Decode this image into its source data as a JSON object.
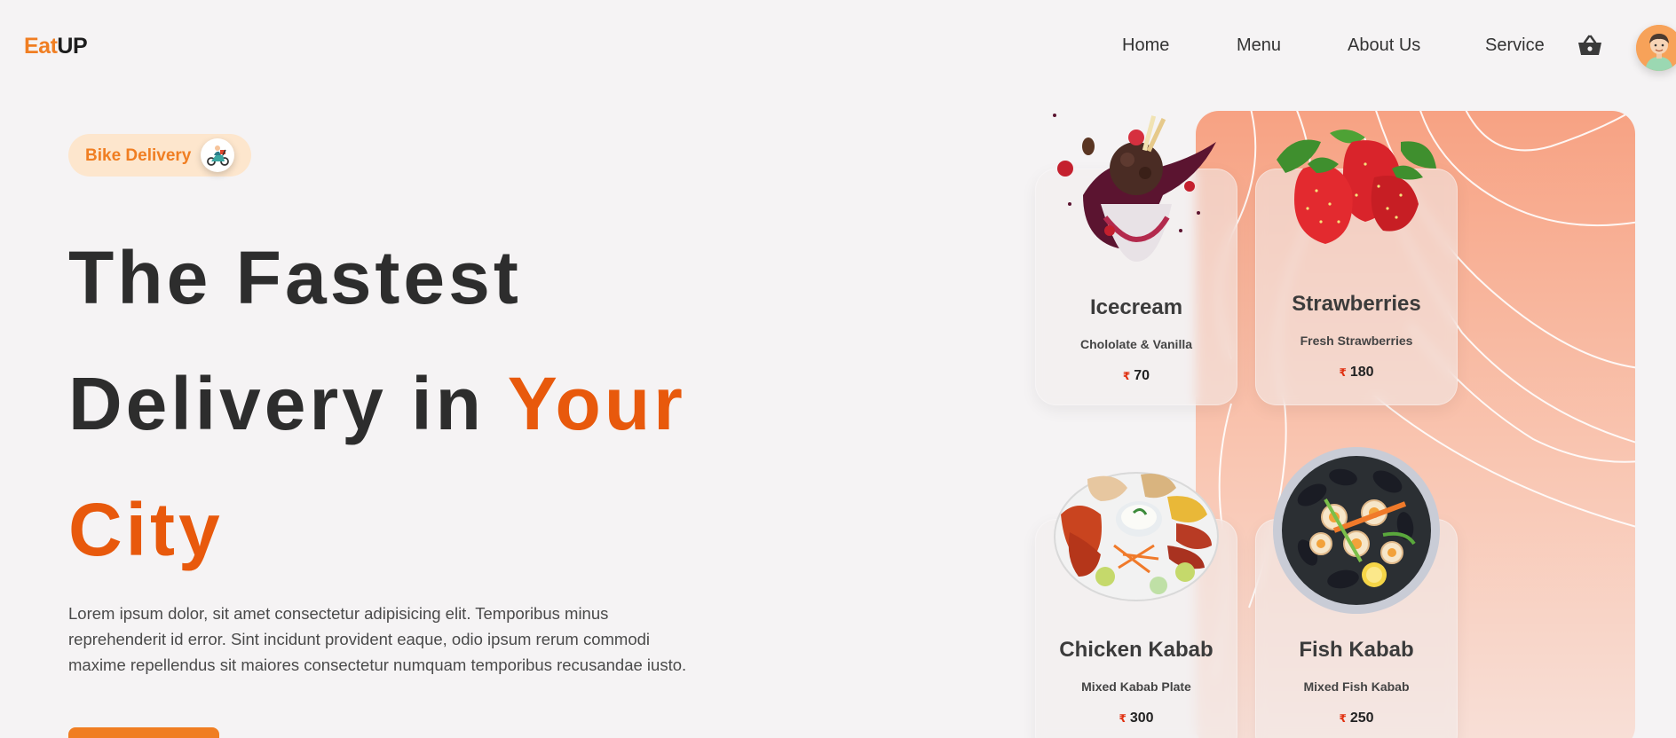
{
  "brand": {
    "part1": "Eat",
    "part2": "UP"
  },
  "nav": {
    "items": [
      "Home",
      "Menu",
      "About Us",
      "Service"
    ],
    "cart_icon": "basket-icon",
    "avatar_icon": "user-avatar"
  },
  "hero": {
    "badge": {
      "label": "Bike Delivery",
      "icon": "scooter-icon"
    },
    "headline": {
      "line1": "The Fastest",
      "line2_plain": "Delivery in",
      "line2_accent": "Your",
      "line3_accent": "City"
    },
    "description": "Lorem ipsum dolor, sit amet consectetur adipisicing elit. Temporibus minus reprehenderit id error. Sint incidunt provident eaque, odio ipsum rerum commodi maxime repellendus sit maiores consectetur numquam temporibus recusandae iusto."
  },
  "menu": [
    {
      "name": "Icecream",
      "desc": "Chololate & Vanilla",
      "currency": "₹",
      "price": "70",
      "image": "icecream-image"
    },
    {
      "name": "Strawberries",
      "desc": "Fresh Strawberries",
      "currency": "₹",
      "price": "180",
      "image": "strawberries-image"
    },
    {
      "name": "Chicken Kabab",
      "desc": "Mixed Kabab Plate",
      "currency": "₹",
      "price": "300",
      "image": "chicken-kabab-image"
    },
    {
      "name": "Fish Kabab",
      "desc": "Mixed Fish Kabab",
      "currency": "₹",
      "price": "250",
      "image": "fish-kabab-image"
    }
  ],
  "colors": {
    "accent": "#f07e22",
    "headline_accent": "#e8590c",
    "background": "#f5f3f4",
    "panel_top": "#f7a283"
  }
}
